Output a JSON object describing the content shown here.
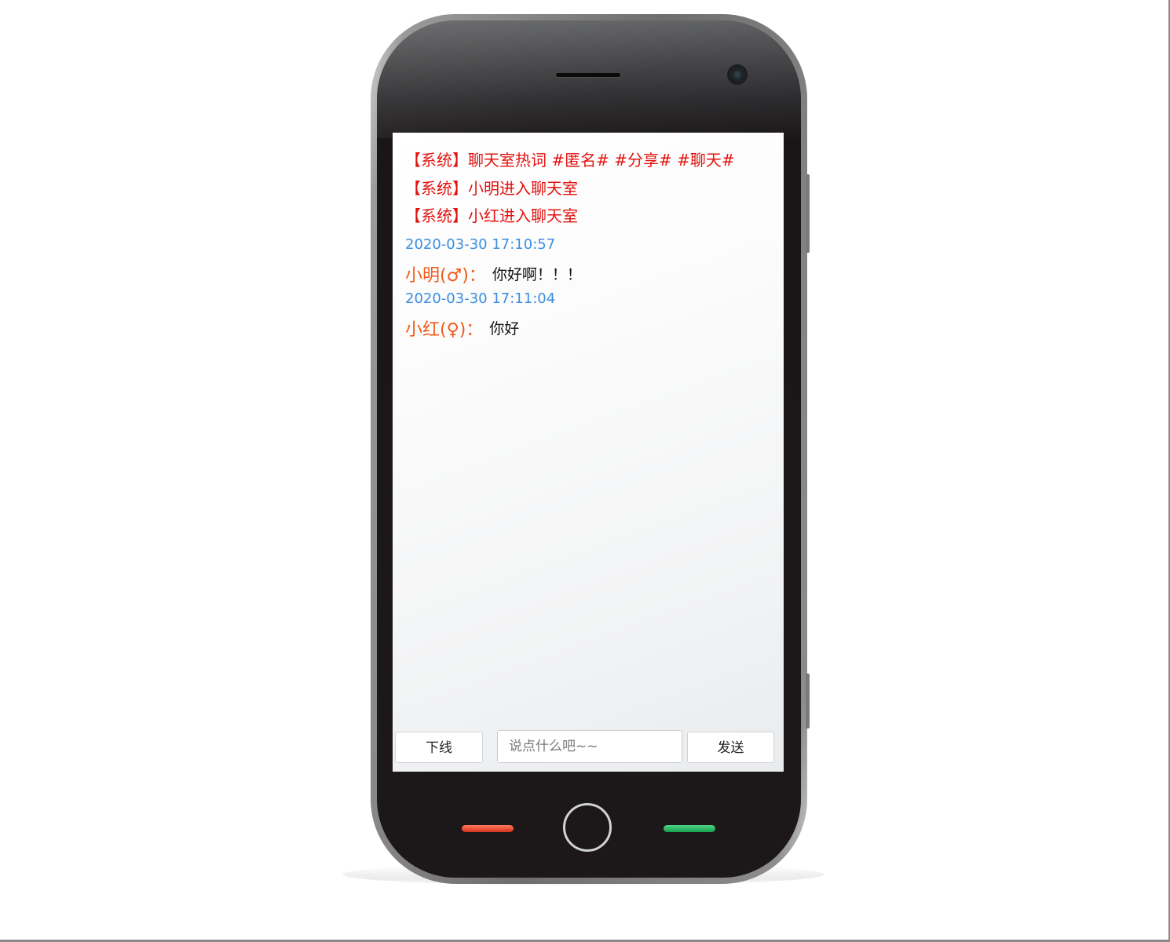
{
  "chat": {
    "system_messages": [
      "【系统】聊天室热词 #匿名# #分享# #聊天#",
      "【系统】小明进入聊天室",
      "【系统】小红进入聊天室"
    ],
    "messages": [
      {
        "time": "2020-03-30 17:10:57",
        "user": "小明(♂)：",
        "text": "你好啊！！！"
      },
      {
        "time": "2020-03-30 17:11:04",
        "user": "小红(♀)：",
        "text": "你好"
      }
    ]
  },
  "controls": {
    "offline_label": "下线",
    "input_placeholder": "说点什么吧~~",
    "input_value": "",
    "send_label": "发送"
  },
  "colors": {
    "system_text": "#e3120f",
    "timestamp": "#3b8de0",
    "username": "#f05a1a",
    "message_text": "#111111",
    "hangup_bar": "#e0432a",
    "call_bar": "#21b35b"
  },
  "icons": {
    "speaker": "earpiece-speaker-icon",
    "camera": "front-camera-icon",
    "home": "home-button-icon",
    "hangup": "hangup-bar-icon",
    "call": "call-bar-icon"
  }
}
